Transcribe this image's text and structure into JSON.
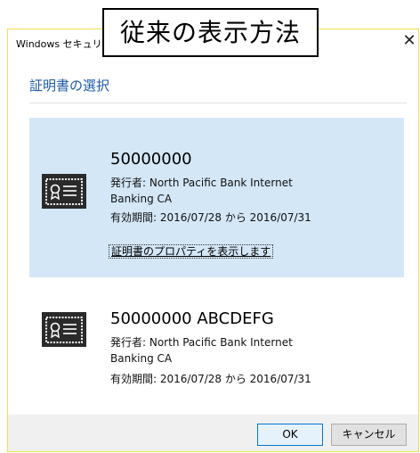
{
  "window": {
    "title": "Windows セキュリ",
    "close_glyph": "✕"
  },
  "callout": {
    "text": "従来の表示方法"
  },
  "dialog": {
    "heading": "証明書の選択"
  },
  "certificates": [
    {
      "name": "50000000",
      "issuer_line1": "発行者: North Pacific Bank Internet",
      "issuer_line2": "Banking CA",
      "validity": "有効期間: 2016/07/28 から 2016/07/31",
      "properties_link": "証明書のプロパティを表示します",
      "selected": true
    },
    {
      "name": "50000000 ABCDEFG",
      "issuer_line1": "発行者: North Pacific Bank Internet",
      "issuer_line2": "Banking CA",
      "validity": "有効期間: 2016/07/28 から 2016/07/31",
      "selected": false
    }
  ],
  "buttons": {
    "ok": "OK",
    "cancel": "キャンセル"
  },
  "colors": {
    "selection": "#d4e7f7",
    "heading": "#1c5aa8",
    "frame_accent": "#f1e24a"
  }
}
